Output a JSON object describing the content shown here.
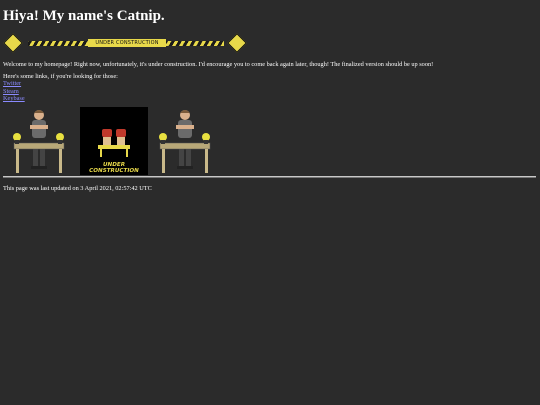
{
  "header": {
    "title": "Hiya! My name's Catnip."
  },
  "banner": {
    "label": "UNDER CONSTRUCTION",
    "accent_color": "#e8d94a"
  },
  "main": {
    "welcome_text": "Welcome to my homepage! Right now, unfortunately, it's under construction. I'd encourage you to come back again later, though! The finalized version should be up soon!",
    "links_intro": "Here's some links, if you're looking for those:",
    "links": [
      {
        "label": "Twitter"
      },
      {
        "label": "Steam"
      },
      {
        "label": "Keybase"
      }
    ],
    "link_color": "#8a8aff"
  },
  "images": {
    "gif_caption_line1": "UNDER",
    "gif_caption_line2": "CONSTRUCTION",
    "icons": [
      "construction-worker-icon",
      "under-construction-gif",
      "construction-worker-icon"
    ]
  },
  "footer": {
    "last_updated": "This page was last updated on 3 April 2021, 02:57:42 UTC"
  },
  "colors": {
    "background": "#2b2b2b",
    "text": "#ffffff"
  }
}
